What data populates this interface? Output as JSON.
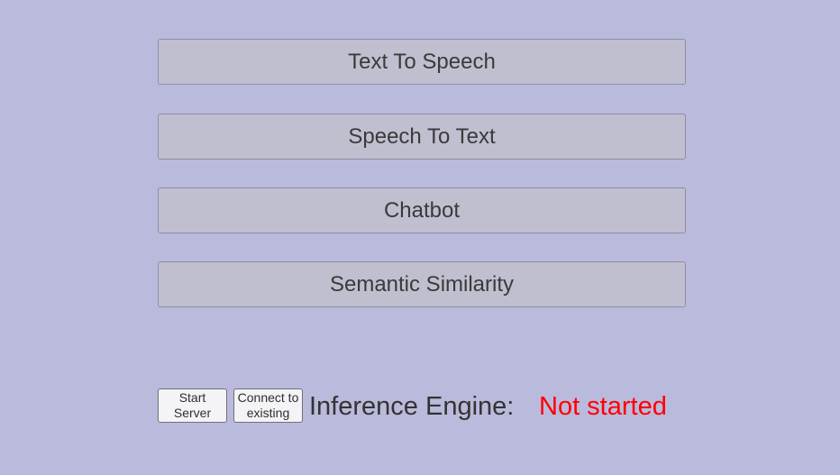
{
  "menu": {
    "text_to_speech_label": "Text To Speech",
    "speech_to_text_label": "Speech To Text",
    "chatbot_label": "Chatbot",
    "semantic_similarity_label": "Semantic Similarity"
  },
  "server": {
    "start_label": "Start\nServer",
    "connect_label": "Connect to\nexisting",
    "engine_label": "Inference Engine:",
    "engine_status": "Not started",
    "status_color": "#ff0000"
  },
  "colors": {
    "background": "#babadc",
    "button_fill": "#c0bfd0"
  }
}
